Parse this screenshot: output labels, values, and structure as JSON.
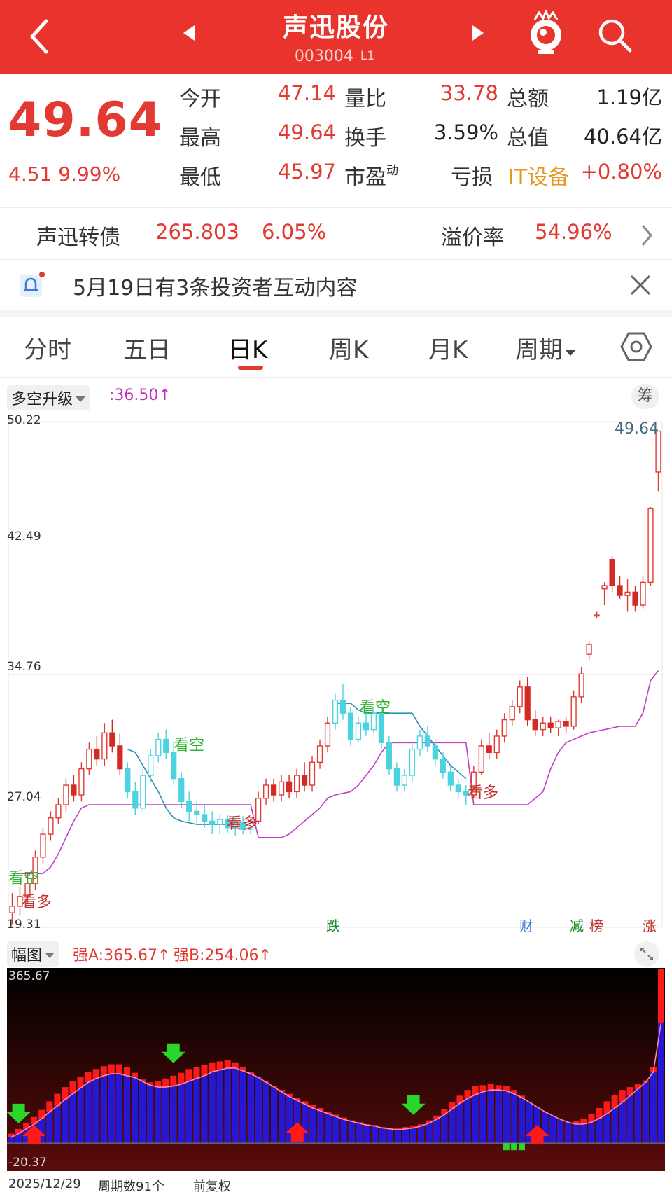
{
  "header": {
    "title": "声迅股份",
    "code": "003004",
    "badge": "L1"
  },
  "quote": {
    "price": "49.64",
    "change": "4.51",
    "change_pct": "9.99%",
    "fields": [
      {
        "label": "今开",
        "value": "47.14",
        "color": "red"
      },
      {
        "label": "量比",
        "value": "33.78",
        "color": "red"
      },
      {
        "label": "总额",
        "value": "1.19亿",
        "color": "black"
      },
      {
        "label": "最高",
        "value": "49.64",
        "color": "red"
      },
      {
        "label": "换手",
        "value": "3.59%",
        "color": "black"
      },
      {
        "label": "总值",
        "value": "40.64亿",
        "color": "black"
      },
      {
        "label": "最低",
        "value": "45.97",
        "color": "red"
      },
      {
        "label": "市盈",
        "value": "",
        "color": "red"
      },
      {
        "label": "亏损",
        "value": "+0.80%",
        "color": "red"
      }
    ],
    "pe_sup": "动",
    "industry": "IT设备"
  },
  "bond": {
    "name": "声迅转债",
    "price": "265.803",
    "pct": "6.05%",
    "premium_label": "溢价率",
    "premium": "54.96%"
  },
  "notice": {
    "text": "5月19日有3条投资者互动内容"
  },
  "tabs": [
    "分时",
    "五日",
    "日K",
    "周K",
    "月K",
    "周期"
  ],
  "indicator": {
    "name": "多空升级",
    "value": ":36.50↑",
    "chip_btn": "筹"
  },
  "chart_data": [
    {
      "type": "candlestick",
      "y_ticks": [
        "50.22",
        "42.49",
        "34.76",
        "27.04",
        "19.31"
      ],
      "ylim": [
        19.31,
        50.22
      ],
      "last_label": "49.64",
      "markers": [
        {
          "text": "看空",
          "color": "#2fb32f"
        },
        {
          "text": "看多",
          "color": "#c0322b"
        },
        {
          "text": "看空",
          "color": "#2fb32f"
        },
        {
          "text": "看多",
          "color": "#c0322b"
        },
        {
          "text": "看空",
          "color": "#2fb32f"
        },
        {
          "text": "看多",
          "color": "#c0322b"
        }
      ],
      "events": [
        {
          "text": "跌",
          "color": "#1a8c2c"
        },
        {
          "text": "财",
          "color": "#3b7bd6"
        },
        {
          "text": "减",
          "color": "#1a8c2c"
        },
        {
          "text": "榜",
          "color": "#c0322b"
        },
        {
          "text": "涨",
          "color": "#c0322b"
        }
      ],
      "candles": [
        [
          20.2,
          21.4,
          19.5,
          20.6
        ],
        [
          20.6,
          21.8,
          20.0,
          21.2
        ],
        [
          21.2,
          22.6,
          20.8,
          22.0
        ],
        [
          22.0,
          24.0,
          21.6,
          23.6
        ],
        [
          23.6,
          25.4,
          23.2,
          25.0
        ],
        [
          25.0,
          26.4,
          24.6,
          26.0
        ],
        [
          26.0,
          27.2,
          25.6,
          26.8
        ],
        [
          26.8,
          28.4,
          26.4,
          28.0
        ],
        [
          28.0,
          28.6,
          27.0,
          27.4
        ],
        [
          27.4,
          29.4,
          27.0,
          29.0
        ],
        [
          29.0,
          30.6,
          28.6,
          30.2
        ],
        [
          30.2,
          31.0,
          29.2,
          29.6
        ],
        [
          29.6,
          31.8,
          29.2,
          31.2
        ],
        [
          31.2,
          32.0,
          30.0,
          30.4
        ],
        [
          30.4,
          31.2,
          28.6,
          29.0
        ],
        [
          29.0,
          29.4,
          27.2,
          27.6
        ],
        [
          27.6,
          28.2,
          26.2,
          26.6
        ],
        [
          26.6,
          29.0,
          26.4,
          28.6
        ],
        [
          28.6,
          30.2,
          28.2,
          29.8
        ],
        [
          29.8,
          31.2,
          29.4,
          30.8
        ],
        [
          30.8,
          31.4,
          29.6,
          30.0
        ],
        [
          30.0,
          30.6,
          28.0,
          28.4
        ],
        [
          28.4,
          28.8,
          26.6,
          27.0
        ],
        [
          27.0,
          27.6,
          25.8,
          26.4
        ],
        [
          26.4,
          27.0,
          25.6,
          26.2
        ],
        [
          26.2,
          26.8,
          25.4,
          25.8
        ],
        [
          25.8,
          26.4,
          25.0,
          25.6
        ],
        [
          25.6,
          26.2,
          25.0,
          25.9
        ],
        [
          25.9,
          26.2,
          25.1,
          25.4
        ],
        [
          25.4,
          26.0,
          24.9,
          25.7
        ],
        [
          25.7,
          26.1,
          25.0,
          25.3
        ],
        [
          25.3,
          26.0,
          25.0,
          25.8
        ],
        [
          25.8,
          27.6,
          25.6,
          27.2
        ],
        [
          27.2,
          28.4,
          26.8,
          28.0
        ],
        [
          28.0,
          28.4,
          27.0,
          27.4
        ],
        [
          27.4,
          28.6,
          27.0,
          28.2
        ],
        [
          28.2,
          28.6,
          27.2,
          27.6
        ],
        [
          27.6,
          29.0,
          27.2,
          28.6
        ],
        [
          28.6,
          29.4,
          27.6,
          28.0
        ],
        [
          28.0,
          29.8,
          27.6,
          29.4
        ],
        [
          29.4,
          30.8,
          29.0,
          30.4
        ],
        [
          30.4,
          32.2,
          30.0,
          31.8
        ],
        [
          31.8,
          33.6,
          31.4,
          33.2
        ],
        [
          33.2,
          34.2,
          32.0,
          32.4
        ],
        [
          32.4,
          32.8,
          30.4,
          30.8
        ],
        [
          30.8,
          32.2,
          30.6,
          31.8
        ],
        [
          31.8,
          32.6,
          31.0,
          31.4
        ],
        [
          31.4,
          32.8,
          31.2,
          32.4
        ],
        [
          32.4,
          33.0,
          30.2,
          30.6
        ],
        [
          30.6,
          31.0,
          28.6,
          29.0
        ],
        [
          29.0,
          29.4,
          27.6,
          28.0
        ],
        [
          28.0,
          29.0,
          27.6,
          28.6
        ],
        [
          28.6,
          30.6,
          28.2,
          30.2
        ],
        [
          30.2,
          31.4,
          29.8,
          31.0
        ],
        [
          31.0,
          31.6,
          30.0,
          30.4
        ],
        [
          30.4,
          30.8,
          29.2,
          29.6
        ],
        [
          29.6,
          30.0,
          28.4,
          28.8
        ],
        [
          28.8,
          29.2,
          27.6,
          28.0
        ],
        [
          28.0,
          28.4,
          27.2,
          27.6
        ],
        [
          27.6,
          28.0,
          26.8,
          27.4
        ],
        [
          27.4,
          29.2,
          27.2,
          28.8
        ],
        [
          28.8,
          30.8,
          28.6,
          30.4
        ],
        [
          30.4,
          31.2,
          29.6,
          30.0
        ],
        [
          30.0,
          31.4,
          29.6,
          31.0
        ],
        [
          31.0,
          32.4,
          30.6,
          32.0
        ],
        [
          32.0,
          33.2,
          31.6,
          32.8
        ],
        [
          32.8,
          34.4,
          32.4,
          34.0
        ],
        [
          34.0,
          34.6,
          31.6,
          32.0
        ],
        [
          32.0,
          32.6,
          31.0,
          31.4
        ],
        [
          31.4,
          32.2,
          31.0,
          31.8
        ],
        [
          31.8,
          32.2,
          31.2,
          31.5
        ],
        [
          31.5,
          32.0,
          31.0,
          31.9
        ],
        [
          31.9,
          32.2,
          31.2,
          31.6
        ],
        [
          31.6,
          33.8,
          31.4,
          33.4
        ],
        [
          33.4,
          35.2,
          33.0,
          34.8
        ],
        [
          36.0,
          36.8,
          35.6,
          36.6
        ],
        [
          38.4,
          38.6,
          38.2,
          38.4
        ],
        [
          40.0,
          40.4,
          39.0,
          40.2
        ],
        [
          41.8,
          42.0,
          39.8,
          40.2
        ],
        [
          40.2,
          40.8,
          39.4,
          39.6
        ],
        [
          39.6,
          40.6,
          38.6,
          39.8
        ],
        [
          39.8,
          40.2,
          38.6,
          39.0
        ],
        [
          39.0,
          40.8,
          38.8,
          40.4
        ],
        [
          40.4,
          45.0,
          40.2,
          44.9
        ],
        [
          47.14,
          49.64,
          45.97,
          49.64
        ]
      ],
      "trailing_stop": [
        22.6,
        22.6,
        22.6,
        22.6,
        22.6,
        23.0,
        23.8,
        24.8,
        25.8,
        26.6,
        26.8,
        26.8,
        26.8,
        26.8,
        26.8,
        26.8,
        26.8,
        26.8,
        26.8,
        26.8,
        26.8,
        26.8,
        26.8,
        26.8,
        26.8,
        26.8,
        26.8,
        26.8,
        26.8,
        26.8,
        26.8,
        26.8,
        24.8,
        24.8,
        24.8,
        24.8,
        25.0,
        25.4,
        25.8,
        26.2,
        26.6,
        27.2,
        27.4,
        27.5,
        27.6,
        28.0,
        28.6,
        29.2,
        30.0,
        30.6,
        30.6,
        30.6,
        30.6,
        30.6,
        30.6,
        30.6,
        30.6,
        30.6,
        30.6,
        30.6,
        26.8,
        26.8,
        26.8,
        26.8,
        26.8,
        26.8,
        26.8,
        26.8,
        27.2,
        27.6,
        29.0,
        30.0,
        30.6,
        30.8,
        31.0,
        31.2,
        31.3,
        31.4,
        31.5,
        31.6,
        31.6,
        31.6,
        32.4,
        34.4,
        35.0
      ],
      "resistance": [
        null,
        null,
        null,
        null,
        null,
        null,
        null,
        null,
        null,
        null,
        null,
        null,
        null,
        null,
        null,
        30.2,
        30.0,
        29.2,
        28.4,
        27.6,
        26.6,
        26.0,
        25.8,
        25.7,
        25.6,
        25.6,
        25.6,
        25.6,
        25.6,
        25.6,
        25.6,
        25.6,
        null,
        null,
        null,
        null,
        null,
        null,
        null,
        null,
        null,
        null,
        33.0,
        33.0,
        33.0,
        32.6,
        32.4,
        32.4,
        32.4,
        32.4,
        32.4,
        32.4,
        32.4,
        31.6,
        31.0,
        30.4,
        29.8,
        29.2,
        28.8,
        28.4,
        null,
        null,
        null,
        null,
        null,
        null,
        null,
        null,
        null,
        null,
        null,
        null,
        null,
        null,
        null,
        null,
        null,
        null,
        null,
        null,
        null,
        null,
        null,
        null,
        null
      ]
    },
    {
      "type": "bar",
      "name": "幅图",
      "legend": [
        {
          "name": "强A:365.67↑",
          "color": "#e23a33"
        },
        {
          "name": "强B:254.06↑",
          "color": "#e23a33"
        }
      ],
      "ylim": [
        -20.37,
        365.67
      ],
      "y_ticks": [
        "365.67",
        "-20.37"
      ],
      "series": [
        {
          "name": "强A",
          "values": [
            20,
            30,
            42,
            55,
            70,
            88,
            104,
            118,
            130,
            140,
            150,
            156,
            162,
            166,
            166,
            160,
            148,
            134,
            128,
            130,
            136,
            142,
            148,
            156,
            160,
            164,
            170,
            172,
            174,
            170,
            160,
            150,
            140,
            130,
            120,
            112,
            104,
            96,
            88,
            80,
            74,
            66,
            60,
            54,
            48,
            44,
            40,
            38,
            34,
            32,
            32,
            34,
            36,
            40,
            48,
            58,
            72,
            86,
            100,
            112,
            120,
            122,
            124,
            122,
            120,
            112,
            100,
            86,
            72,
            60,
            52,
            46,
            44,
            46,
            52,
            62,
            74,
            88,
            102,
            112,
            118,
            124,
            132,
            160,
            365.67
          ]
        },
        {
          "name": "强B",
          "values": [
            12,
            20,
            30,
            40,
            52,
            66,
            78,
            92,
            104,
            116,
            128,
            136,
            142,
            146,
            146,
            142,
            138,
            130,
            122,
            118,
            118,
            120,
            124,
            130,
            136,
            142,
            150,
            154,
            158,
            158,
            152,
            146,
            138,
            128,
            118,
            108,
            98,
            90,
            82,
            74,
            68,
            62,
            56,
            50,
            46,
            42,
            38,
            36,
            32,
            30,
            28,
            30,
            32,
            36,
            42,
            50,
            60,
            72,
            84,
            94,
            102,
            108,
            112,
            112,
            110,
            104,
            96,
            86,
            76,
            66,
            58,
            50,
            44,
            40,
            40,
            44,
            52,
            62,
            74,
            86,
            100,
            114,
            128,
            150,
            254.06
          ]
        }
      ]
    }
  ],
  "footer": {
    "date": "2025/12/29",
    "count": "周期数91个",
    "adjust": "前复权"
  }
}
